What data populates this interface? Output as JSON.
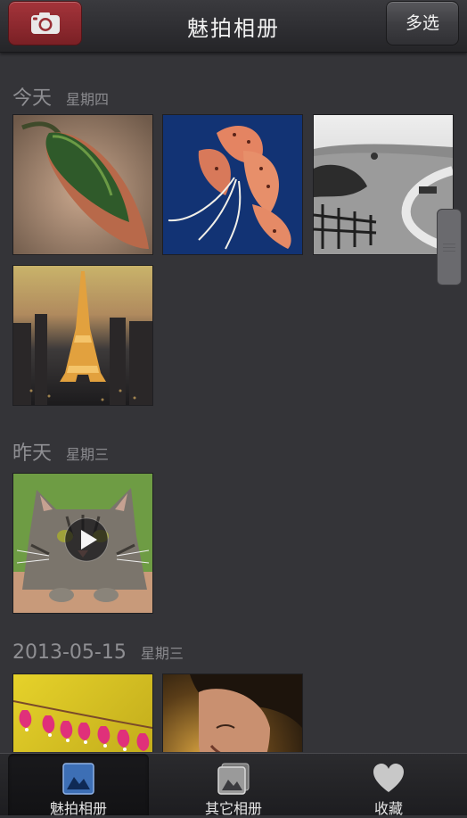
{
  "header": {
    "title": "魅拍相册",
    "camera_icon": "camera-icon",
    "multi_select_label": "多选",
    "camera_button_color": "#9a2f35"
  },
  "sections": [
    {
      "date": "今天",
      "weekday": "星期四",
      "photos": [
        {
          "subject": "green seed pod",
          "icon": "photo-thumbnail"
        },
        {
          "subject": "orange lily on blue",
          "icon": "photo-thumbnail"
        },
        {
          "subject": "black and white countryside road",
          "icon": "photo-thumbnail"
        },
        {
          "subject": "eiffel tower at dusk",
          "icon": "photo-thumbnail"
        }
      ]
    },
    {
      "date": "昨天",
      "weekday": "星期三",
      "photos": [
        {
          "subject": "tabby kitten",
          "icon": "video-thumbnail",
          "is_video": true
        }
      ]
    },
    {
      "date": "2013-05-15",
      "weekday": "星期三",
      "photos": [
        {
          "subject": "pink bleeding heart flowers",
          "icon": "photo-thumbnail"
        },
        {
          "subject": "smiling woman portrait",
          "icon": "photo-thumbnail"
        }
      ]
    }
  ],
  "tabbar": {
    "tabs": [
      {
        "label": "魅拍相册",
        "icon": "gallery-icon",
        "active": true
      },
      {
        "label": "其它相册",
        "icon": "albums-icon",
        "active": false
      },
      {
        "label": "收藏",
        "icon": "heart-icon",
        "active": false
      }
    ]
  },
  "colors": {
    "background": "#343438",
    "active_tab_icon": "#3d6fb5"
  }
}
